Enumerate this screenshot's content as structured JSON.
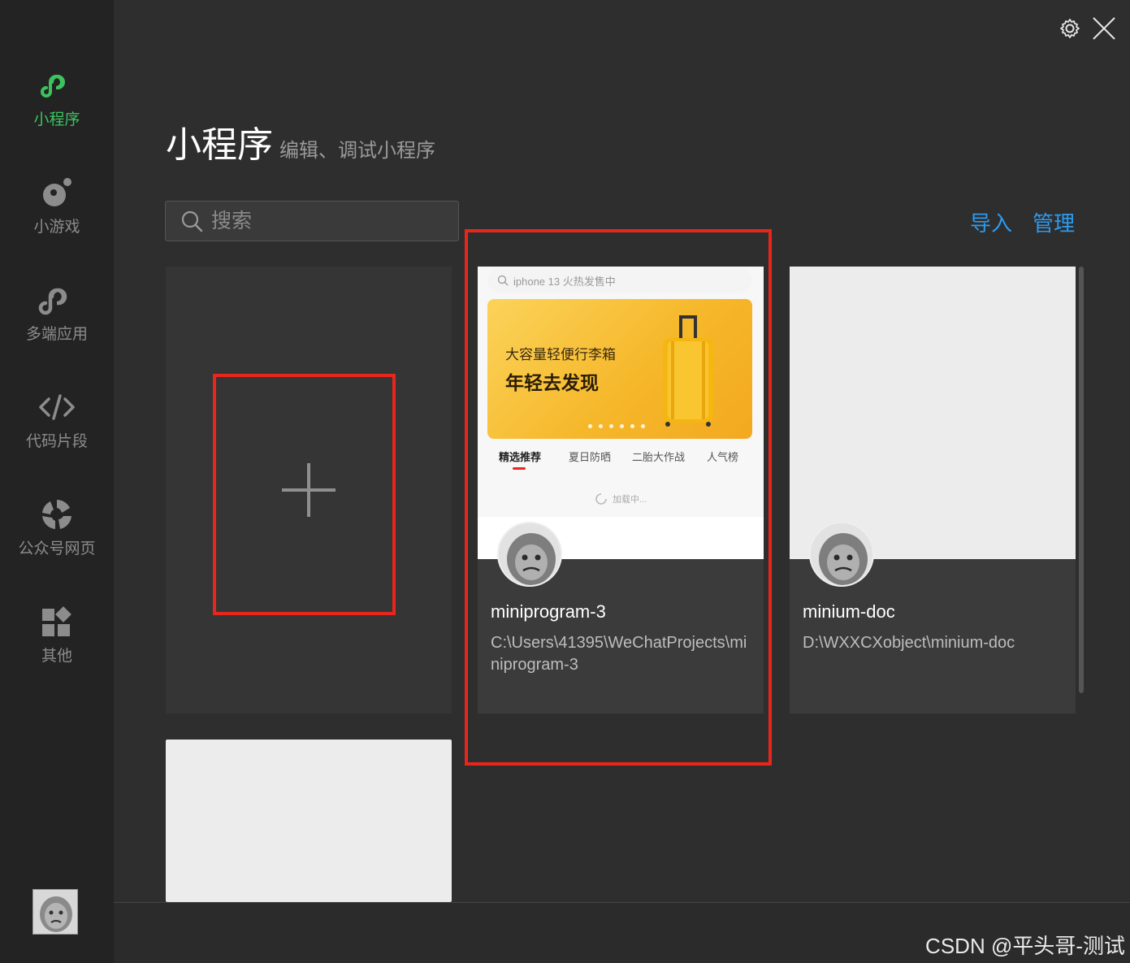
{
  "sidebar": {
    "items": [
      {
        "label": "小程序",
        "icon": "miniprogram-icon"
      },
      {
        "label": "小游戏",
        "icon": "minigame-icon"
      },
      {
        "label": "多端应用",
        "icon": "multiplatform-icon"
      },
      {
        "label": "代码片段",
        "icon": "code-snippet-icon"
      },
      {
        "label": "公众号网页",
        "icon": "official-account-icon"
      },
      {
        "label": "其他",
        "icon": "apps-grid-icon"
      }
    ],
    "active_index": 0
  },
  "header": {
    "title": "小程序",
    "subtitle": "编辑、调试小程序"
  },
  "search": {
    "placeholder": "搜索"
  },
  "actions": {
    "import_label": "导入",
    "manage_label": "管理"
  },
  "projects": [
    {
      "name": "miniprogram-3",
      "path": "C:\\Users\\41395\\WeChatProjects\\miniprogram-3",
      "preview": {
        "search_text": "iphone 13 火热发售中",
        "banner_line1": "大容量轻便行李箱",
        "banner_line2": "年轻去发现",
        "tabs": [
          "精选推荐",
          "夏日防晒",
          "二胎大作战",
          "人气榜"
        ],
        "loading_text": "加载中..."
      }
    },
    {
      "name": "minium-doc",
      "path": "D:\\WXXCXobject\\minium-doc"
    }
  ],
  "watermark": "CSDN @平头哥-测试",
  "colors": {
    "accent_green": "#3cc35f",
    "link_blue": "#2c9bf0",
    "highlight_red": "#e8261c"
  }
}
